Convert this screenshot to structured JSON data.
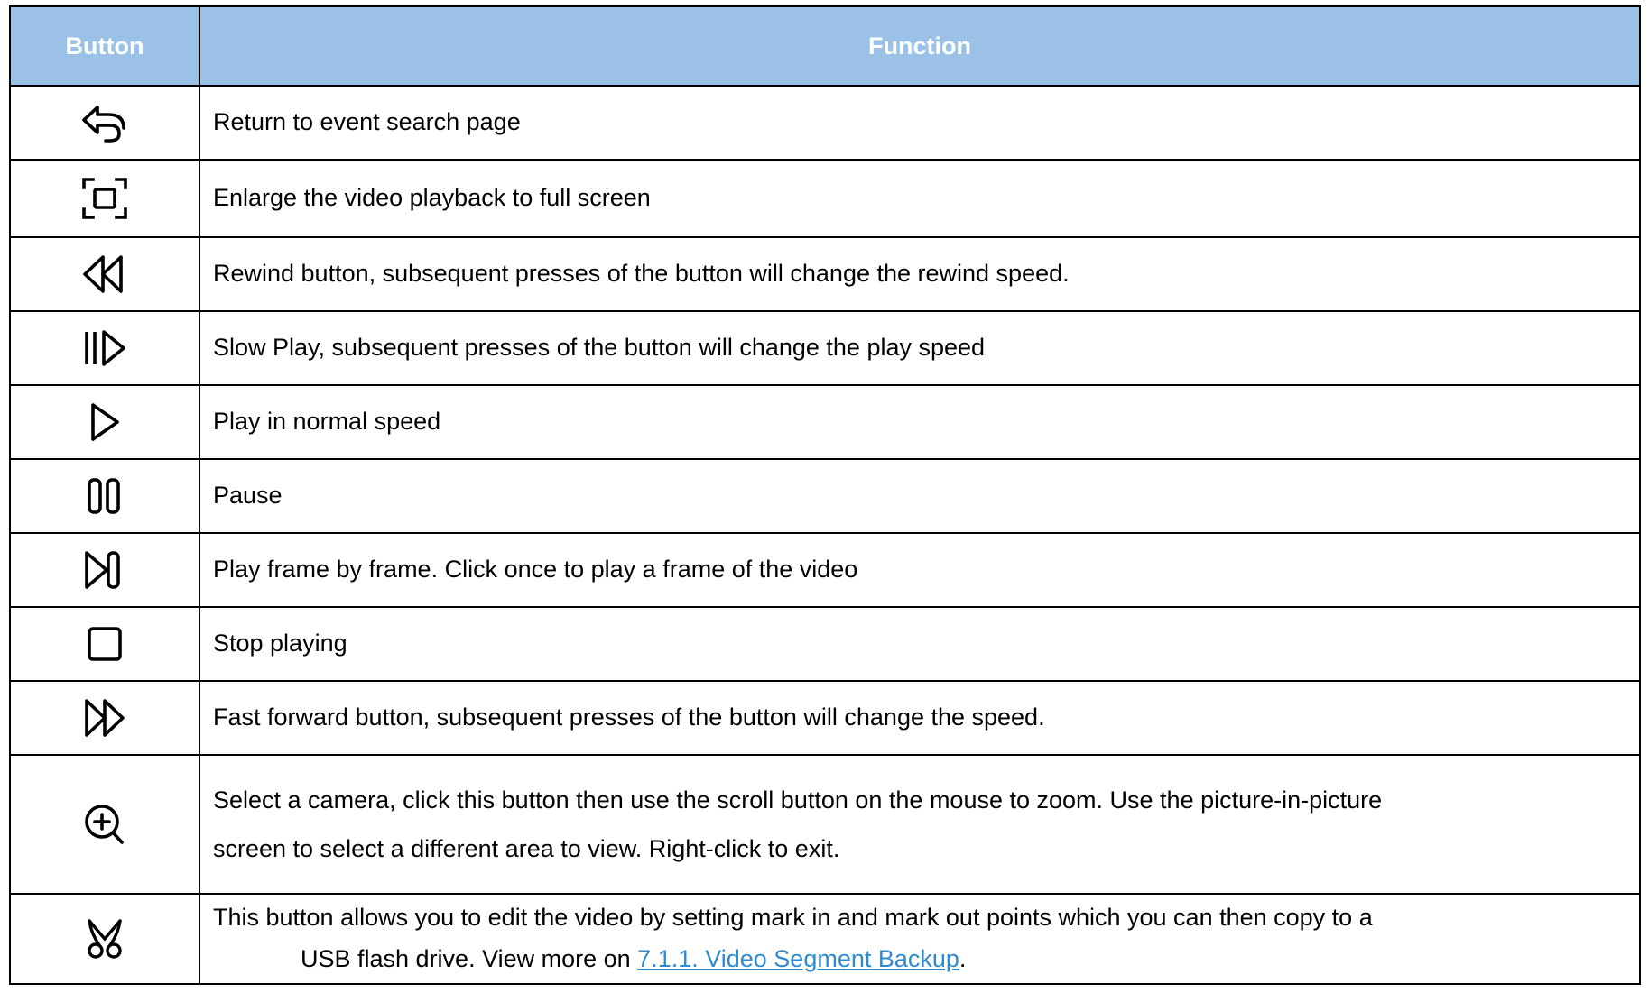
{
  "table": {
    "headers": {
      "button": "Button",
      "function": "Function"
    },
    "rows": [
      {
        "icon": "return-icon",
        "function": "Return to event search page"
      },
      {
        "icon": "fullscreen-icon",
        "function": "Enlarge the video playback to full screen"
      },
      {
        "icon": "rewind-icon",
        "function": "Rewind button, subsequent presses of the button will change the rewind speed."
      },
      {
        "icon": "slow-play-icon",
        "function": "Slow Play, subsequent presses of the button will change the play speed"
      },
      {
        "icon": "play-icon",
        "function": "Play in normal speed"
      },
      {
        "icon": "pause-icon",
        "function": "Pause"
      },
      {
        "icon": "frame-step-icon",
        "function": "Play frame by frame. Click once to play a frame of the video"
      },
      {
        "icon": "stop-icon",
        "function": "Stop playing"
      },
      {
        "icon": "fast-forward-icon",
        "function": "Fast forward button, subsequent presses of the button will change the speed."
      },
      {
        "icon": "zoom-in-icon",
        "function_line1": "Select a camera, click this button then use the scroll button on the mouse to zoom. Use the picture-in-picture",
        "function_line2": "screen to select a different area to view. Right-click to exit."
      },
      {
        "icon": "scissors-icon",
        "function_line1": "This button allows you to edit the video by setting mark in and mark out points which you can then copy to a",
        "function_line2_prefix": "USB flash drive. View more on ",
        "function_link": "7.1.1. Video Segment Backup",
        "function_line2_suffix": "."
      }
    ]
  },
  "colors": {
    "header_bg": "#9bc2e6",
    "header_text": "#ffffff",
    "border": "#000000",
    "link": "#2e8bd0"
  }
}
